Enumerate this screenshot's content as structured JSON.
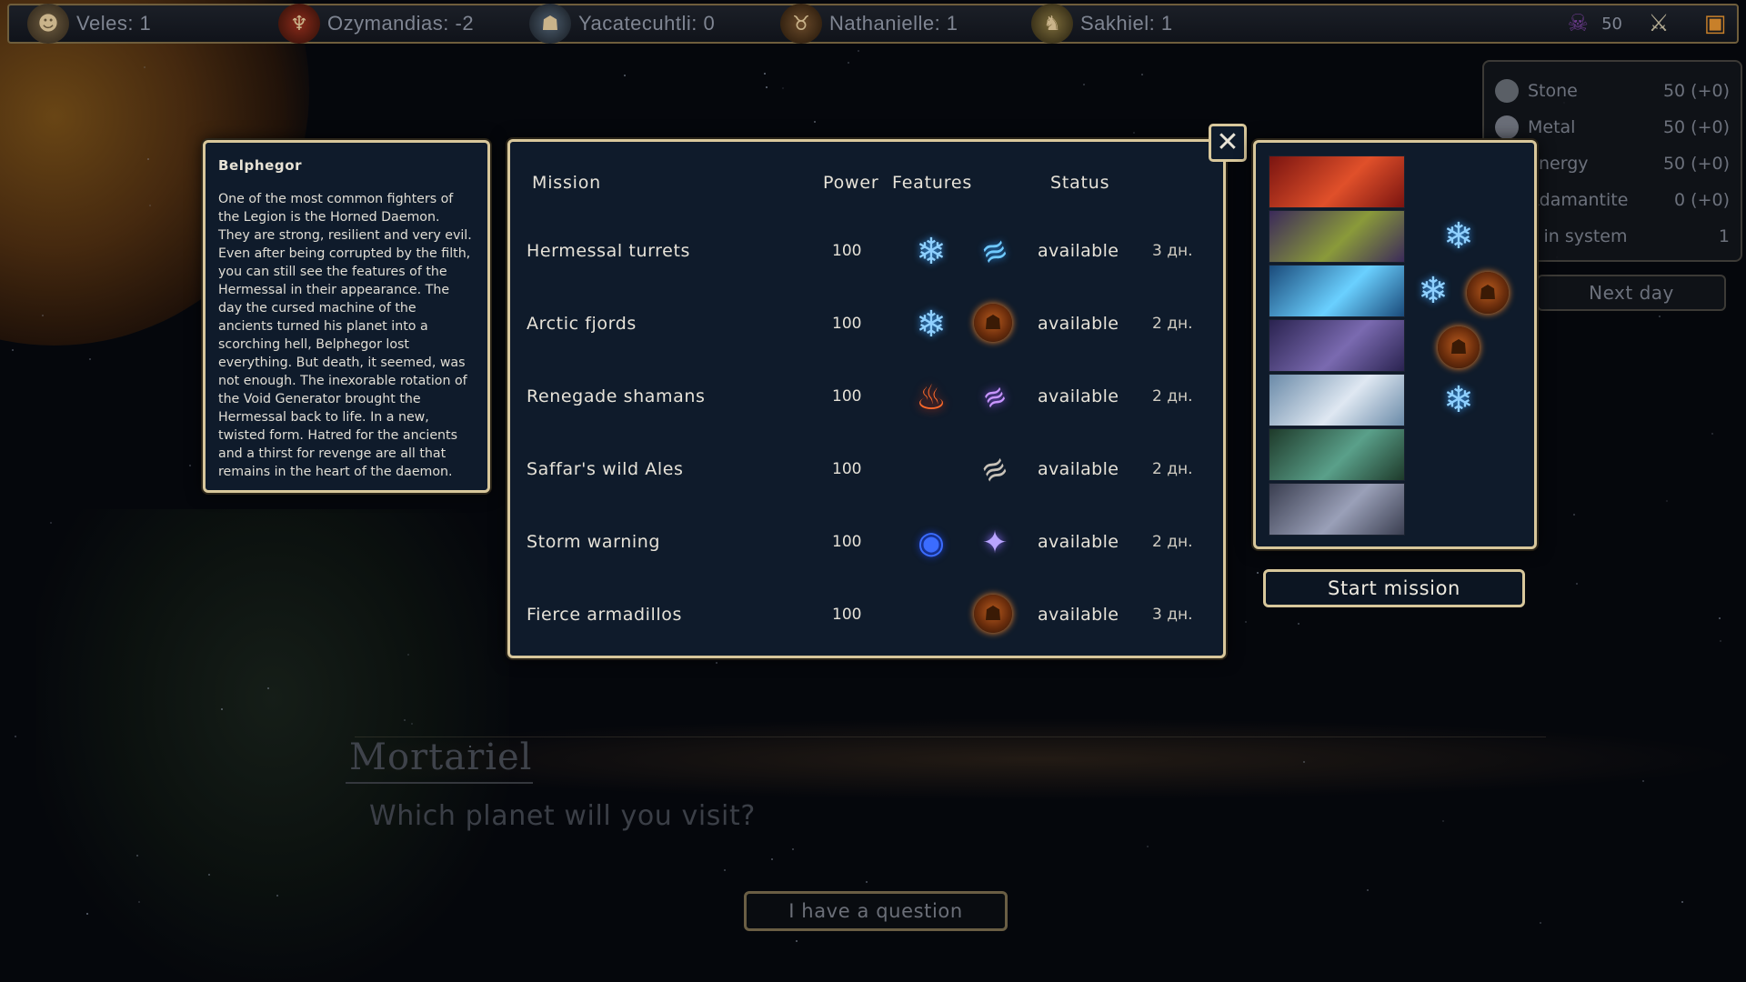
{
  "players": [
    {
      "name": "Veles: 1",
      "icon": "ogre-avatar-icon"
    },
    {
      "name": "Ozymandias: -2",
      "icon": "winged-avatar-icon"
    },
    {
      "name": "Yacatecuhtli: 0",
      "icon": "hooded-avatar-icon"
    },
    {
      "name": "Nathanielle: 1",
      "icon": "horned-avatar-icon"
    },
    {
      "name": "Sakhiel: 1",
      "icon": "beast-avatar-icon"
    }
  ],
  "topright": {
    "count": "50",
    "icons": [
      "demon-icon",
      "crossed-swords-icon",
      "treasure-chest-icon"
    ]
  },
  "resources": [
    {
      "name": "Stone",
      "value": "50 (+0)"
    },
    {
      "name": "Metal",
      "value": "50 (+0)"
    },
    {
      "name": "Energy",
      "value": "50 (+0)"
    },
    {
      "name": "Adamantite",
      "value": "0 (+0)"
    },
    {
      "name": "Days in system",
      "value": "1"
    }
  ],
  "next_day_label": "Next day",
  "character": {
    "name": "Belphegor",
    "description": "One of the most common fighters of the Legion is the Horned Daemon. They are strong, resilient and very evil. Even after being corrupted by the filth, you can still see the features of the Hermessal in their appearance. The day the cursed machine of the ancients turned his planet into a scorching hell, Belphegor lost everything. But death, it seemed, was not enough. The inexorable rotation of the Void Generator brought the Hermessal back to life. In a new, twisted form. Hatred for the ancients and a thirst for revenge are all that remains in the heart of the daemon."
  },
  "mission_table": {
    "headers": {
      "mission": "Mission",
      "power": "Power",
      "features": "Features",
      "status": "Status"
    },
    "rows": [
      {
        "name": "Hermessal turrets",
        "power": "100",
        "features": [
          "frost-icon",
          "wind-blades-icon"
        ],
        "status": "available",
        "days": "3 дн."
      },
      {
        "name": "Arctic fjords",
        "power": "100",
        "features": [
          "frost-icon",
          "ogre-icon"
        ],
        "status": "available",
        "days": "2 дн."
      },
      {
        "name": "Renegade shamans",
        "power": "100",
        "features": [
          "fire-icon",
          "purple-blades-icon"
        ],
        "status": "available",
        "days": "2 дн."
      },
      {
        "name": "Saffar's wild Ales",
        "power": "100",
        "features": [
          "",
          "claw-icon"
        ],
        "status": "available",
        "days": "2 дн."
      },
      {
        "name": "Storm warning",
        "power": "100",
        "features": [
          "storm-icon",
          "crystal-icon"
        ],
        "status": "available",
        "days": "2 дн."
      },
      {
        "name": "Fierce armadillos",
        "power": "100",
        "features": [
          "",
          "ogre-icon"
        ],
        "status": "available",
        "days": "3 дн."
      }
    ]
  },
  "heroes": [
    {
      "portrait": "red-dragon-portrait",
      "colors": [
        "#7a1410",
        "#e0502a"
      ],
      "features": []
    },
    {
      "portrait": "elf-druid-portrait",
      "colors": [
        "#3b2a5a",
        "#8a9a3a"
      ],
      "features": [
        "frost-icon"
      ]
    },
    {
      "portrait": "frost-mage-portrait",
      "colors": [
        "#1a4a7a",
        "#6ad0ff"
      ],
      "features": [
        "frost-icon",
        "ogre-icon"
      ]
    },
    {
      "portrait": "shadow-sorceress-portrait",
      "colors": [
        "#2a2350",
        "#7a6ab0"
      ],
      "features": [
        "ogre-icon"
      ]
    },
    {
      "portrait": "white-priestess-portrait",
      "colors": [
        "#6a8aa8",
        "#dfe8f2"
      ],
      "features": [
        "frost-icon"
      ]
    },
    {
      "portrait": "orc-warrior-portrait",
      "colors": [
        "#1e3a2a",
        "#5aa08a"
      ],
      "features": []
    },
    {
      "portrait": "dark-elf-portrait",
      "colors": [
        "#3a3e50",
        "#9aa0b8"
      ],
      "features": []
    }
  ],
  "start_mission_label": "Start mission",
  "dialogue": {
    "speaker": "Mortariel",
    "question": "Which planet will you visit?",
    "answer_button": "I have a question"
  },
  "accent": "#d8c79b"
}
